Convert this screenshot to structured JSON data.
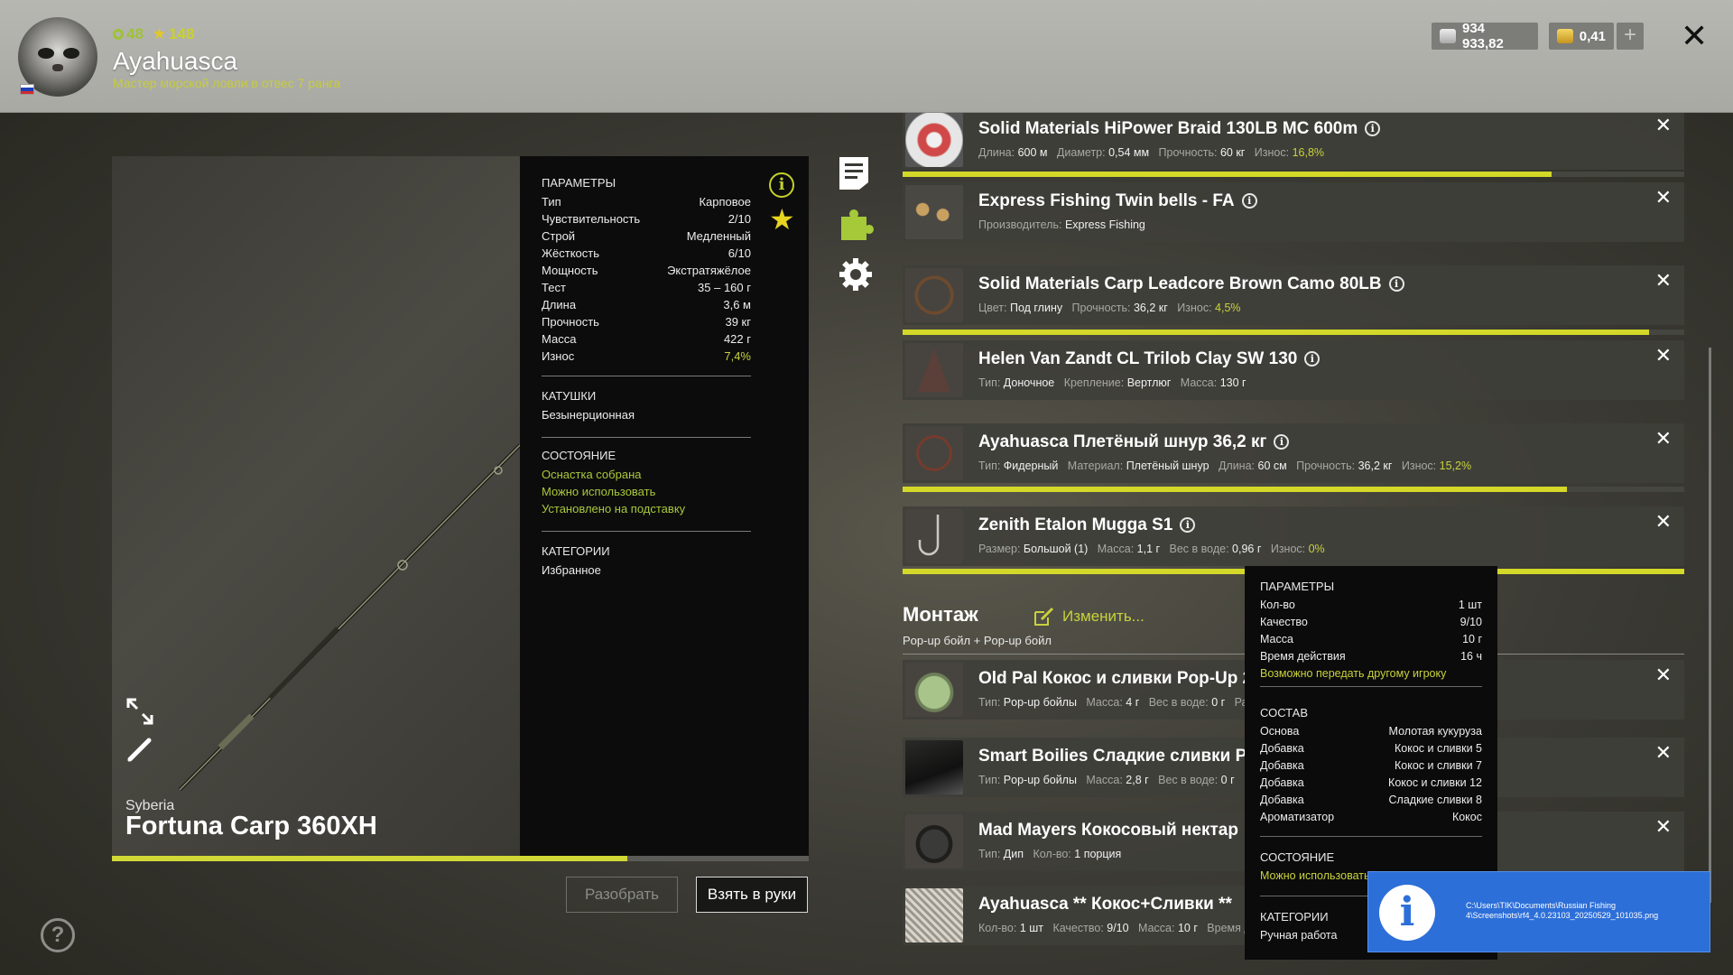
{
  "player": {
    "level": "48",
    "rating": "148",
    "name": "Ayahuasca",
    "rank": "Мастер морской ловли в отвес 7 ранга"
  },
  "currency": {
    "silver": "934 933,82",
    "gold": "0,41",
    "add": "+"
  },
  "rod": {
    "brand": "Syberia",
    "model": "Fortuna Carp 360XH",
    "wear_fraction": 0.74
  },
  "params": {
    "title": "ПАРАМЕТРЫ",
    "rows": [
      {
        "k": "Тип",
        "v": "Карповое"
      },
      {
        "k": "Чувствительность",
        "v": "2/10"
      },
      {
        "k": "Строй",
        "v": "Медленный"
      },
      {
        "k": "Жёсткость",
        "v": "6/10"
      },
      {
        "k": "Мощность",
        "v": "Экстратяжёлое"
      },
      {
        "k": "Тест",
        "v": "35 – 160 г"
      },
      {
        "k": "Длина",
        "v": "3,6 м"
      },
      {
        "k": "Прочность",
        "v": "39 кг"
      },
      {
        "k": "Масса",
        "v": "422 г"
      },
      {
        "k": "Износ",
        "v": "7,4%"
      }
    ],
    "reels_title": "КАТУШКИ",
    "reels_value": "Безынерционная",
    "state_title": "СОСТОЯНИЕ",
    "state_items": [
      "Оснастка собрана",
      "Можно использовать",
      "Установлено на подставку"
    ],
    "categories_title": "КАТЕГОРИИ",
    "categories_value": "Избранное"
  },
  "buttons": {
    "disassemble": "Разобрать",
    "take": "Взять в руки"
  },
  "tackle": [
    {
      "name": "Solid Materials HiPower Braid 130LB MC 600m",
      "meta": [
        [
          "Длина:",
          "600 м"
        ],
        [
          "Диаметр:",
          "0,54 мм"
        ],
        [
          "Прочность:",
          "60 кг"
        ],
        [
          "Износ:",
          "16,8%"
        ]
      ],
      "bar": 0.83
    },
    {
      "name": "Express Fishing Twin bells - FA",
      "meta": [
        [
          "Производитель:",
          "Express Fishing"
        ]
      ]
    },
    {
      "name": "Solid Materials Carp Leadcore Brown Camo 80LB",
      "meta": [
        [
          "Цвет:",
          "Под глину"
        ],
        [
          "Прочность:",
          "36,2 кг"
        ],
        [
          "Износ:",
          "4,5%"
        ]
      ],
      "bar": 0.955
    },
    {
      "name": "Helen Van Zandt CL Trilob Clay SW 130",
      "meta": [
        [
          "Тип:",
          "Доночное"
        ],
        [
          "Крепление:",
          "Вертлюг"
        ],
        [
          "Масса:",
          "130 г"
        ]
      ]
    },
    {
      "name": "Ayahuasca Плетёный шнур 36,2 кг",
      "meta": [
        [
          "Тип:",
          "Фидерный"
        ],
        [
          "Материал:",
          "Плетёный шнур"
        ],
        [
          "Длина:",
          "60 см"
        ],
        [
          "Прочность:",
          "36,2 кг"
        ],
        [
          "Износ:",
          "15,2%"
        ]
      ],
      "bar": 0.85
    },
    {
      "name": "Zenith Etalon Mugga S1",
      "meta": [
        [
          "Размер:",
          "Большой (1)"
        ],
        [
          "Масса:",
          "1,1 г"
        ],
        [
          "Вес в воде:",
          "0,96 г"
        ],
        [
          "Износ:",
          "0%"
        ]
      ],
      "bar": 1.0
    }
  ],
  "montage": {
    "title": "Монтаж",
    "edit": "Изменить...",
    "subtitle": "Pop-up бойл  +  Pop-up бойл",
    "items": [
      {
        "name": "Old Pal Кокос и сливки Pop-Up 22",
        "meta": [
          [
            "Тип:",
            "Pop-up бойлы"
          ],
          [
            "Масса:",
            "4 г"
          ],
          [
            "Вес в воде:",
            "0 г"
          ],
          [
            "Раз",
            ""
          ]
        ]
      },
      {
        "name": "Smart Boilies Сладкие сливки Pop",
        "meta": [
          [
            "Тип:",
            "Pop-up бойлы"
          ],
          [
            "Масса:",
            "2,8 г"
          ],
          [
            "Вес в воде:",
            "0 г"
          ],
          [
            "Р",
            ""
          ]
        ]
      },
      {
        "name": "Mad Mayers Кокосовый нектар",
        "meta": [
          [
            "Тип:",
            "Дип"
          ],
          [
            "Кол-во:",
            "1 порция"
          ]
        ]
      },
      {
        "name": "Ayahuasca ** Кокос+Сливки **",
        "meta": [
          [
            "Кол-во:",
            "1 шт"
          ],
          [
            "Качество:",
            "9/10"
          ],
          [
            "Масса:",
            "10 г"
          ],
          [
            "Время д",
            ""
          ]
        ]
      }
    ]
  },
  "tooltip": {
    "params_title": "ПАРАМЕТРЫ",
    "params": [
      {
        "k": "Кол-во",
        "v": "1 шт"
      },
      {
        "k": "Качество",
        "v": "9/10"
      },
      {
        "k": "Масса",
        "v": "10 г"
      },
      {
        "k": "Время действия",
        "v": "16 ч"
      }
    ],
    "transfer_note": "Возможно передать другому игроку",
    "composition_title": "СОСТАВ",
    "composition": [
      {
        "k": "Основа",
        "v": "Молотая кукуруза"
      },
      {
        "k": "Добавка",
        "v": "Кокос и сливки 5"
      },
      {
        "k": "Добавка",
        "v": "Кокос и сливки 7"
      },
      {
        "k": "Добавка",
        "v": "Кокос и сливки 12"
      },
      {
        "k": "Добавка",
        "v": "Сладкие сливки 8"
      },
      {
        "k": "Ароматизатор",
        "v": "Кокос"
      }
    ],
    "state_title": "СОСТОЯНИЕ",
    "state_value": "Можно использовать",
    "categories_title": "КАТЕГОРИИ",
    "categories_value": "Ручная работа"
  },
  "notification": {
    "path": "C:\\Users\\TIK\\Documents\\Russian Fishing 4\\Screenshots\\rf4_4.0.23103_20250529_101035.png"
  },
  "colors": {
    "accent": "#c8d23c",
    "wear_bar": "#d3d829",
    "notification": "#2d6fd8"
  }
}
